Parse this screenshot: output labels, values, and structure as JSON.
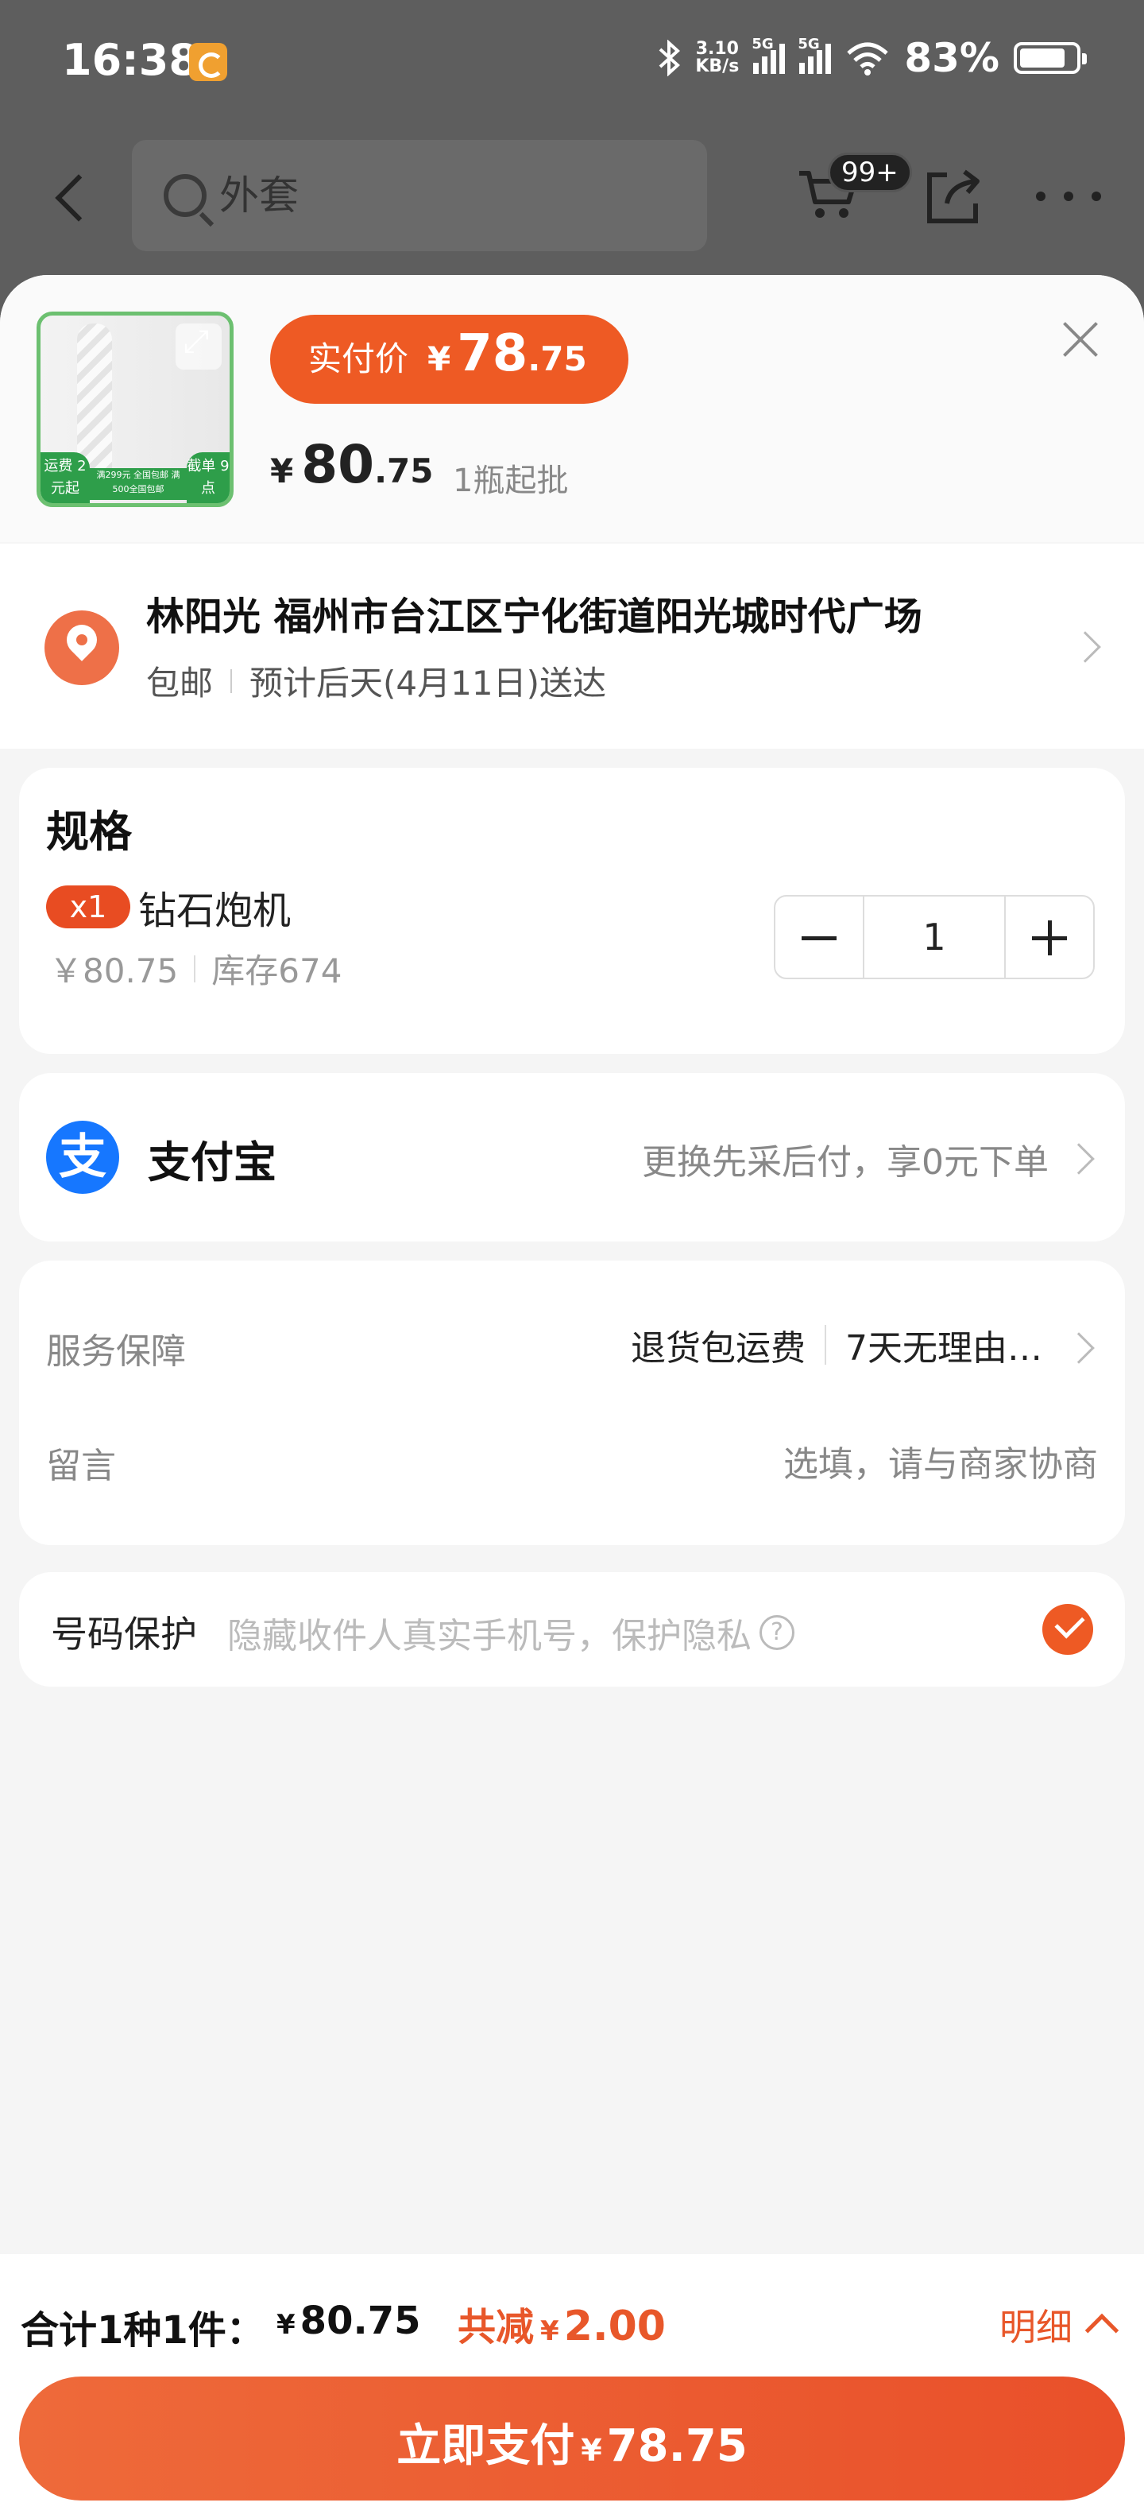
{
  "status_bar": {
    "time": "16:38",
    "net_speed_value": "3.10",
    "net_speed_unit": "KB/s",
    "signal_1": "5G",
    "signal_2": "5G",
    "battery": "83%"
  },
  "nav": {
    "search_placeholder": "外套",
    "cart_badge": "99+"
  },
  "product": {
    "pay_price_label": "实付价",
    "pay_price_currency": "¥",
    "pay_price_int": "78",
    "pay_price_dec": ".75",
    "price_currency": "¥",
    "price_int": "80",
    "price_dec": ".75",
    "min_order": "1瓶起批",
    "thumb_tag_left": "运费 2元起",
    "thumb_tag_right": "截单 9点",
    "thumb_band": "满299元 全国包邮 满500全国包邮"
  },
  "address": {
    "title": "林阳光 福州市台江区宁化街道阳光城时代广场",
    "shipping": "包邮",
    "delivery": "预计后天(4月11日)送达"
  },
  "spec": {
    "title": "规格",
    "qty_tag": "x1",
    "name": "钻石炮机",
    "price": "￥80.75",
    "stock": "库存674",
    "quantity": "1"
  },
  "payment": {
    "method": "支付宝",
    "icon_glyph": "支",
    "tip": "更换先采后付，享0元下单"
  },
  "service": {
    "label": "服务保障",
    "item_1": "退货包运费",
    "item_2": "7天无理由…",
    "memo_label": "留言",
    "memo_placeholder": "选填，请与商家协商"
  },
  "phone_protection": {
    "label": "号码保护",
    "tip": "隐藏收件人真实手机号，保护隐私",
    "help_glyph": "?",
    "checked": true
  },
  "footer": {
    "total_label": "合计1种1件：",
    "total_currency": "¥",
    "total_value": "80.75",
    "discount_label": "共减",
    "discount_currency": "¥",
    "discount_value": "2.00",
    "detail_label": "明细",
    "pay_button_label": "立即支付",
    "pay_button_currency": "¥",
    "pay_button_value": "78.75"
  },
  "colors": {
    "accent": "#ee5a24",
    "alipay_blue": "#1677ff",
    "location_orange": "#ee7048"
  },
  "icons": [
    "back-arrow-icon",
    "search-icon",
    "cart-icon",
    "share-icon",
    "more-icon",
    "expand-icon",
    "close-icon",
    "location-pin-icon",
    "chevron-right-icon",
    "minus-icon",
    "plus-icon",
    "alipay-icon",
    "help-icon",
    "check-icon",
    "chevron-up-icon"
  ]
}
